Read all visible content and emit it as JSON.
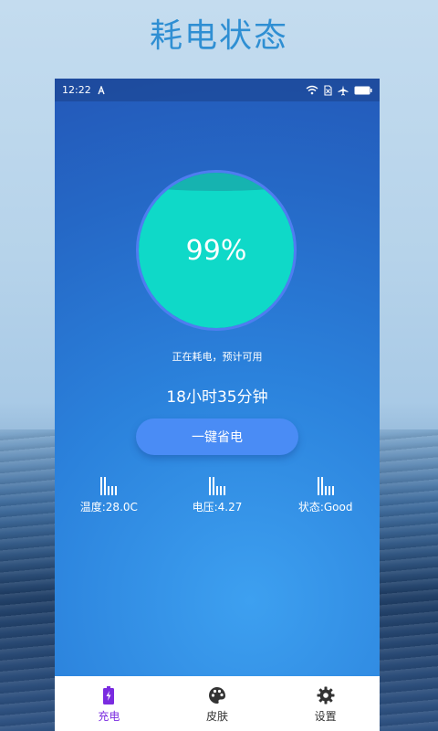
{
  "headline": "耗电状态",
  "status_bar": {
    "time": "12:22"
  },
  "battery": {
    "percent_label": "99%",
    "level": 0.99
  },
  "status_text": "正在耗电，预计可用",
  "remaining_time": "18小时35分钟",
  "save_button_label": "一键省电",
  "stats": [
    {
      "label": "温度:28.0C"
    },
    {
      "label": "电压:4.27"
    },
    {
      "label": "状态:Good"
    }
  ],
  "tabs": [
    {
      "label": "充电",
      "icon": "battery-charging-icon",
      "active": true
    },
    {
      "label": "皮肤",
      "icon": "palette-icon",
      "active": false
    },
    {
      "label": "设置",
      "icon": "gear-icon",
      "active": false
    }
  ],
  "colors": {
    "accent": "#7a2be0",
    "gauge_fill": "#0fd9c8",
    "button": "#4a8cf5",
    "headline": "#2f8fd3"
  }
}
